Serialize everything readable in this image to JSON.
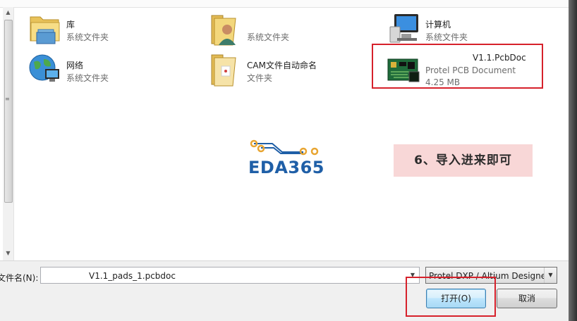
{
  "items": {
    "library": {
      "name": "库",
      "sub": "系统文件夹"
    },
    "user": {
      "name": "",
      "sub": "系统文件夹"
    },
    "computer": {
      "name": "计算机",
      "sub": "系统文件夹"
    },
    "network": {
      "name": "网络",
      "sub": "系统文件夹"
    },
    "cam_folder": {
      "name": "CAM文件自动命名",
      "sub": "文件夹"
    },
    "pcb_file": {
      "name": "V1.1.PcbDoc",
      "type": "Protel PCB Document",
      "size": "4.25 MB"
    }
  },
  "logo": {
    "text": "EDA365"
  },
  "annotation": {
    "text": "6、导入进来即可"
  },
  "bottom": {
    "filename_label": "文件名(N):",
    "filename_value": "V1.1_pads_1.pcbdoc",
    "filetype_value": "Protel DXP / Altium Designer",
    "open_label": "打开(O)",
    "cancel_label": "取消"
  },
  "colors": {
    "highlight": "#d6212b",
    "annotation_bg": "#f8d7d7",
    "logo_blue": "#1f5fa7",
    "logo_orange": "#e8a531"
  }
}
